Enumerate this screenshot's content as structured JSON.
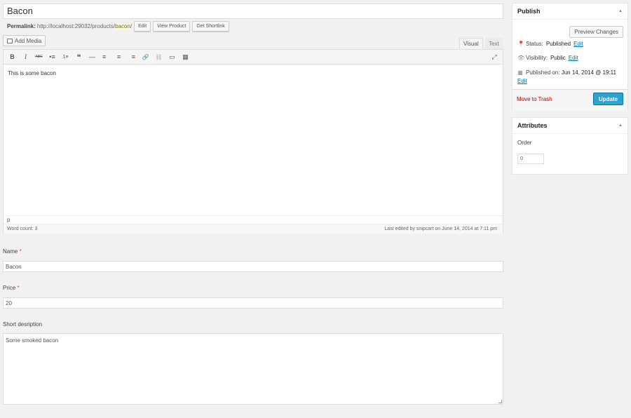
{
  "title_value": "Bacon",
  "permalink": {
    "label": "Permalink:",
    "base_url": "http://localhost:29032/products/",
    "slug": "bacon",
    "trailing": "/",
    "edit_label": "Edit",
    "view_label": "View Product",
    "shortlink_label": "Get Shortlink"
  },
  "add_media_label": "Add Media",
  "editor_tabs": {
    "visual": "Visual",
    "text": "Text"
  },
  "toolbar": {
    "bold": "B",
    "italic": "I",
    "strike": "ABC",
    "ul": "•≡",
    "ol": "1≡",
    "quote": "❝",
    "hr": "—",
    "align_left": "≡",
    "align_center": "≡",
    "align_right": "≡",
    "link": "🔗",
    "unlink": "⛓",
    "more": "▭",
    "kitchen_sink": "▦",
    "fullscreen": "⤢"
  },
  "editor_content": "This is some bacon",
  "path": "p",
  "word_count": "Word count: 3",
  "last_edited": "Last edited by snipcart on June 14, 2014 at 7:11 pm",
  "fields": {
    "name": {
      "label": "Name",
      "required": "*",
      "value": "Bacon"
    },
    "price": {
      "label": "Price",
      "required": "*",
      "value": "20"
    },
    "short_desc": {
      "label": "Short desription",
      "value": "Some smoked bacon"
    }
  },
  "publish": {
    "title": "Publish",
    "preview_label": "Preview Changes",
    "status_label": "Status:",
    "status_value": "Published",
    "visibility_label": "Visibility:",
    "visibility_value": "Public",
    "published_label": "Published on:",
    "published_value": "Jun 14, 2014 @ 19:11",
    "edit_label": "Edit",
    "trash_label": "Move to Trash",
    "update_label": "Update"
  },
  "attributes": {
    "title": "Attributes",
    "order_label": "Order",
    "order_value": "0"
  },
  "colors": {
    "accent": "#2ea2cc",
    "link": "#0074a2",
    "danger": "#a00",
    "required": "#d54e21"
  },
  "icons": {
    "pin": "pin-icon",
    "eye": "eye-icon",
    "calendar": "calendar-icon",
    "collapse": "triangle-up-icon"
  }
}
